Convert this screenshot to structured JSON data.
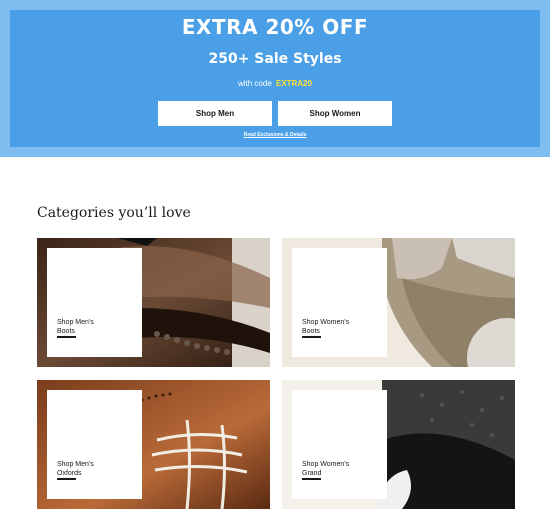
{
  "promo": {
    "headline": "EXTRA 20% OFF",
    "subheadline": "250+ Sale Styles",
    "code_prefix": "with code",
    "code": "EXTRA20",
    "buttons": [
      {
        "label": "Shop Men"
      },
      {
        "label": "Shop Women"
      }
    ],
    "details_link": "Read Exclusions & Details",
    "colors": {
      "banner": "#4a9fe6",
      "banner_border": "#7fbdf0",
      "code": "#ffe033"
    }
  },
  "categories": {
    "title": "Categories you’ll love",
    "tiles": [
      {
        "label_line1": "Shop Men's",
        "label_line2": "Boots"
      },
      {
        "label_line1": "Shop Women's",
        "label_line2": "Boots"
      },
      {
        "label_line1": "Shop Men's",
        "label_line2": "Oxfords"
      },
      {
        "label_line1": "Shop Women's",
        "label_line2": "Grand"
      }
    ]
  }
}
